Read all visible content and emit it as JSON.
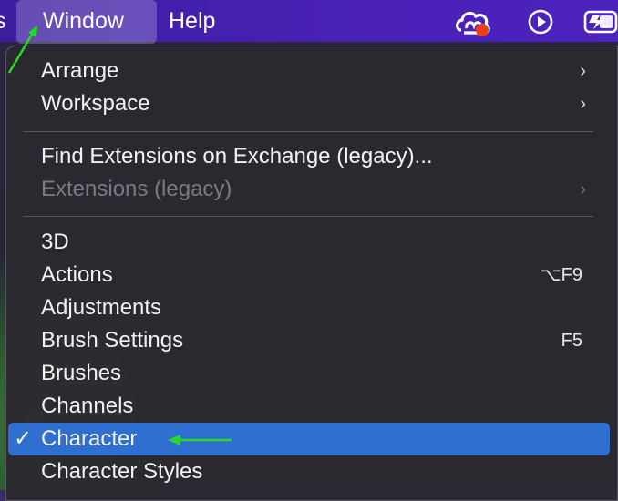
{
  "menubar": {
    "prev_item_fragment": "s",
    "window_label": "Window",
    "help_label": "Help",
    "icons": [
      "creative-cloud-icon",
      "play-circle-icon",
      "battery-charging-icon"
    ],
    "notification_color": "#e8401c"
  },
  "menu": {
    "arrange": "Arrange",
    "workspace": "Workspace",
    "find_extensions": "Find Extensions on Exchange (legacy)...",
    "extensions_legacy": "Extensions (legacy)",
    "item_3d": "3D",
    "actions": "Actions",
    "actions_shortcut": "⌥F9",
    "adjustments": "Adjustments",
    "brush_settings": "Brush Settings",
    "brush_settings_shortcut": "F5",
    "brushes": "Brushes",
    "channels": "Channels",
    "character": "Character",
    "character_checkmark": "✓",
    "character_styles": "Character Styles",
    "submenu_chevron": "›"
  },
  "colors": {
    "highlight": "#2f6fd0",
    "annotation_arrow": "#22dd22"
  }
}
